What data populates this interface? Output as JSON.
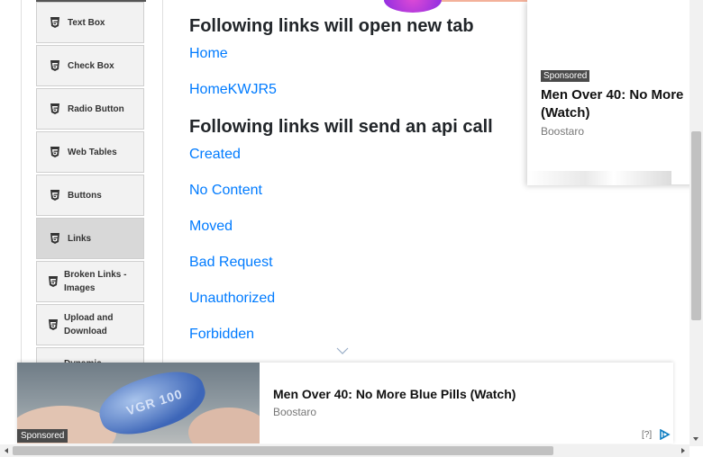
{
  "sidebar": {
    "items": [
      {
        "label": "Text Box",
        "icon": "html5-icon"
      },
      {
        "label": "Check Box",
        "icon": "html5-icon"
      },
      {
        "label": "Radio Button",
        "icon": "html5-icon"
      },
      {
        "label": "Web Tables",
        "icon": "html5-icon"
      },
      {
        "label": "Buttons",
        "icon": "html5-icon"
      },
      {
        "label": "Links",
        "icon": "html5-icon",
        "active": true
      },
      {
        "label": "Broken Links - Images",
        "icon": "html5-icon"
      },
      {
        "label": "Upload and Download",
        "icon": "html5-icon"
      },
      {
        "label": "Dynamic",
        "icon": "html5-icon"
      }
    ]
  },
  "main": {
    "new_tab_heading": "Following links will open new tab",
    "new_tab_links": [
      "Home",
      "HomeKWJR5"
    ],
    "api_heading": "Following links will send an api call",
    "api_links": [
      "Created",
      "No Content",
      "Moved",
      "Bad Request",
      "Unauthorized",
      "Forbidden"
    ]
  },
  "side_ad": {
    "sponsored": "Sponsored",
    "headline_line1": "Men Over 40: No More",
    "headline_line2": "(Watch)",
    "source": "Boostaro"
  },
  "banner_ad": {
    "sponsored": "Sponsored",
    "headline": "Men Over 40: No More Blue Pills (Watch)",
    "source": "Boostaro",
    "help": "[?]",
    "pill_text": "VGR 100"
  },
  "colors": {
    "link": "#007bff",
    "heading": "#212529",
    "sidebar_bg": "#f2f2f2",
    "sidebar_active": "#d8d8d8"
  }
}
